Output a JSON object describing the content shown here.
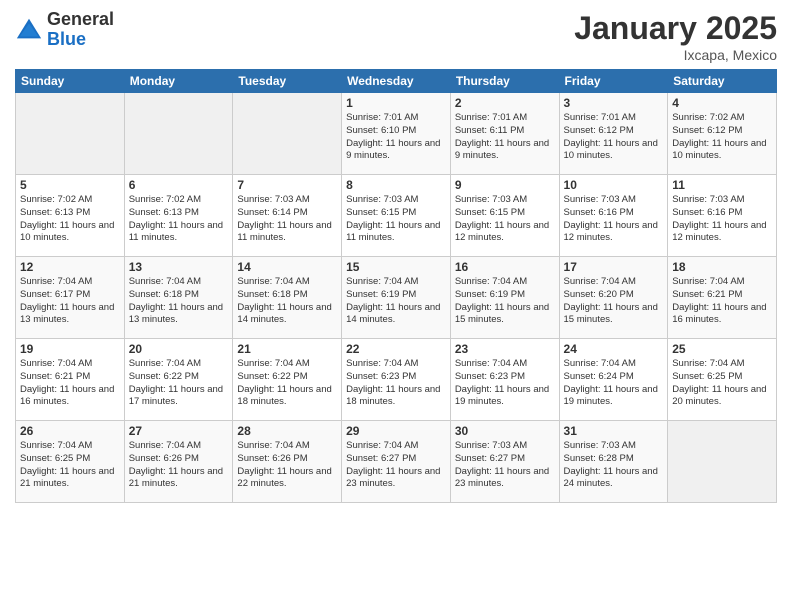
{
  "logo": {
    "general": "General",
    "blue": "Blue"
  },
  "header": {
    "month_year": "January 2025",
    "location": "Ixcapa, Mexico"
  },
  "weekdays": [
    "Sunday",
    "Monday",
    "Tuesday",
    "Wednesday",
    "Thursday",
    "Friday",
    "Saturday"
  ],
  "weeks": [
    [
      {
        "day": "",
        "info": ""
      },
      {
        "day": "",
        "info": ""
      },
      {
        "day": "",
        "info": ""
      },
      {
        "day": "1",
        "info": "Sunrise: 7:01 AM\nSunset: 6:10 PM\nDaylight: 11 hours\nand 9 minutes."
      },
      {
        "day": "2",
        "info": "Sunrise: 7:01 AM\nSunset: 6:11 PM\nDaylight: 11 hours\nand 9 minutes."
      },
      {
        "day": "3",
        "info": "Sunrise: 7:01 AM\nSunset: 6:12 PM\nDaylight: 11 hours\nand 10 minutes."
      },
      {
        "day": "4",
        "info": "Sunrise: 7:02 AM\nSunset: 6:12 PM\nDaylight: 11 hours\nand 10 minutes."
      }
    ],
    [
      {
        "day": "5",
        "info": "Sunrise: 7:02 AM\nSunset: 6:13 PM\nDaylight: 11 hours\nand 10 minutes."
      },
      {
        "day": "6",
        "info": "Sunrise: 7:02 AM\nSunset: 6:13 PM\nDaylight: 11 hours\nand 11 minutes."
      },
      {
        "day": "7",
        "info": "Sunrise: 7:03 AM\nSunset: 6:14 PM\nDaylight: 11 hours\nand 11 minutes."
      },
      {
        "day": "8",
        "info": "Sunrise: 7:03 AM\nSunset: 6:15 PM\nDaylight: 11 hours\nand 11 minutes."
      },
      {
        "day": "9",
        "info": "Sunrise: 7:03 AM\nSunset: 6:15 PM\nDaylight: 11 hours\nand 12 minutes."
      },
      {
        "day": "10",
        "info": "Sunrise: 7:03 AM\nSunset: 6:16 PM\nDaylight: 11 hours\nand 12 minutes."
      },
      {
        "day": "11",
        "info": "Sunrise: 7:03 AM\nSunset: 6:16 PM\nDaylight: 11 hours\nand 12 minutes."
      }
    ],
    [
      {
        "day": "12",
        "info": "Sunrise: 7:04 AM\nSunset: 6:17 PM\nDaylight: 11 hours\nand 13 minutes."
      },
      {
        "day": "13",
        "info": "Sunrise: 7:04 AM\nSunset: 6:18 PM\nDaylight: 11 hours\nand 13 minutes."
      },
      {
        "day": "14",
        "info": "Sunrise: 7:04 AM\nSunset: 6:18 PM\nDaylight: 11 hours\nand 14 minutes."
      },
      {
        "day": "15",
        "info": "Sunrise: 7:04 AM\nSunset: 6:19 PM\nDaylight: 11 hours\nand 14 minutes."
      },
      {
        "day": "16",
        "info": "Sunrise: 7:04 AM\nSunset: 6:19 PM\nDaylight: 11 hours\nand 15 minutes."
      },
      {
        "day": "17",
        "info": "Sunrise: 7:04 AM\nSunset: 6:20 PM\nDaylight: 11 hours\nand 15 minutes."
      },
      {
        "day": "18",
        "info": "Sunrise: 7:04 AM\nSunset: 6:21 PM\nDaylight: 11 hours\nand 16 minutes."
      }
    ],
    [
      {
        "day": "19",
        "info": "Sunrise: 7:04 AM\nSunset: 6:21 PM\nDaylight: 11 hours\nand 16 minutes."
      },
      {
        "day": "20",
        "info": "Sunrise: 7:04 AM\nSunset: 6:22 PM\nDaylight: 11 hours\nand 17 minutes."
      },
      {
        "day": "21",
        "info": "Sunrise: 7:04 AM\nSunset: 6:22 PM\nDaylight: 11 hours\nand 18 minutes."
      },
      {
        "day": "22",
        "info": "Sunrise: 7:04 AM\nSunset: 6:23 PM\nDaylight: 11 hours\nand 18 minutes."
      },
      {
        "day": "23",
        "info": "Sunrise: 7:04 AM\nSunset: 6:23 PM\nDaylight: 11 hours\nand 19 minutes."
      },
      {
        "day": "24",
        "info": "Sunrise: 7:04 AM\nSunset: 6:24 PM\nDaylight: 11 hours\nand 19 minutes."
      },
      {
        "day": "25",
        "info": "Sunrise: 7:04 AM\nSunset: 6:25 PM\nDaylight: 11 hours\nand 20 minutes."
      }
    ],
    [
      {
        "day": "26",
        "info": "Sunrise: 7:04 AM\nSunset: 6:25 PM\nDaylight: 11 hours\nand 21 minutes."
      },
      {
        "day": "27",
        "info": "Sunrise: 7:04 AM\nSunset: 6:26 PM\nDaylight: 11 hours\nand 21 minutes."
      },
      {
        "day": "28",
        "info": "Sunrise: 7:04 AM\nSunset: 6:26 PM\nDaylight: 11 hours\nand 22 minutes."
      },
      {
        "day": "29",
        "info": "Sunrise: 7:04 AM\nSunset: 6:27 PM\nDaylight: 11 hours\nand 23 minutes."
      },
      {
        "day": "30",
        "info": "Sunrise: 7:03 AM\nSunset: 6:27 PM\nDaylight: 11 hours\nand 23 minutes."
      },
      {
        "day": "31",
        "info": "Sunrise: 7:03 AM\nSunset: 6:28 PM\nDaylight: 11 hours\nand 24 minutes."
      },
      {
        "day": "",
        "info": ""
      }
    ]
  ]
}
